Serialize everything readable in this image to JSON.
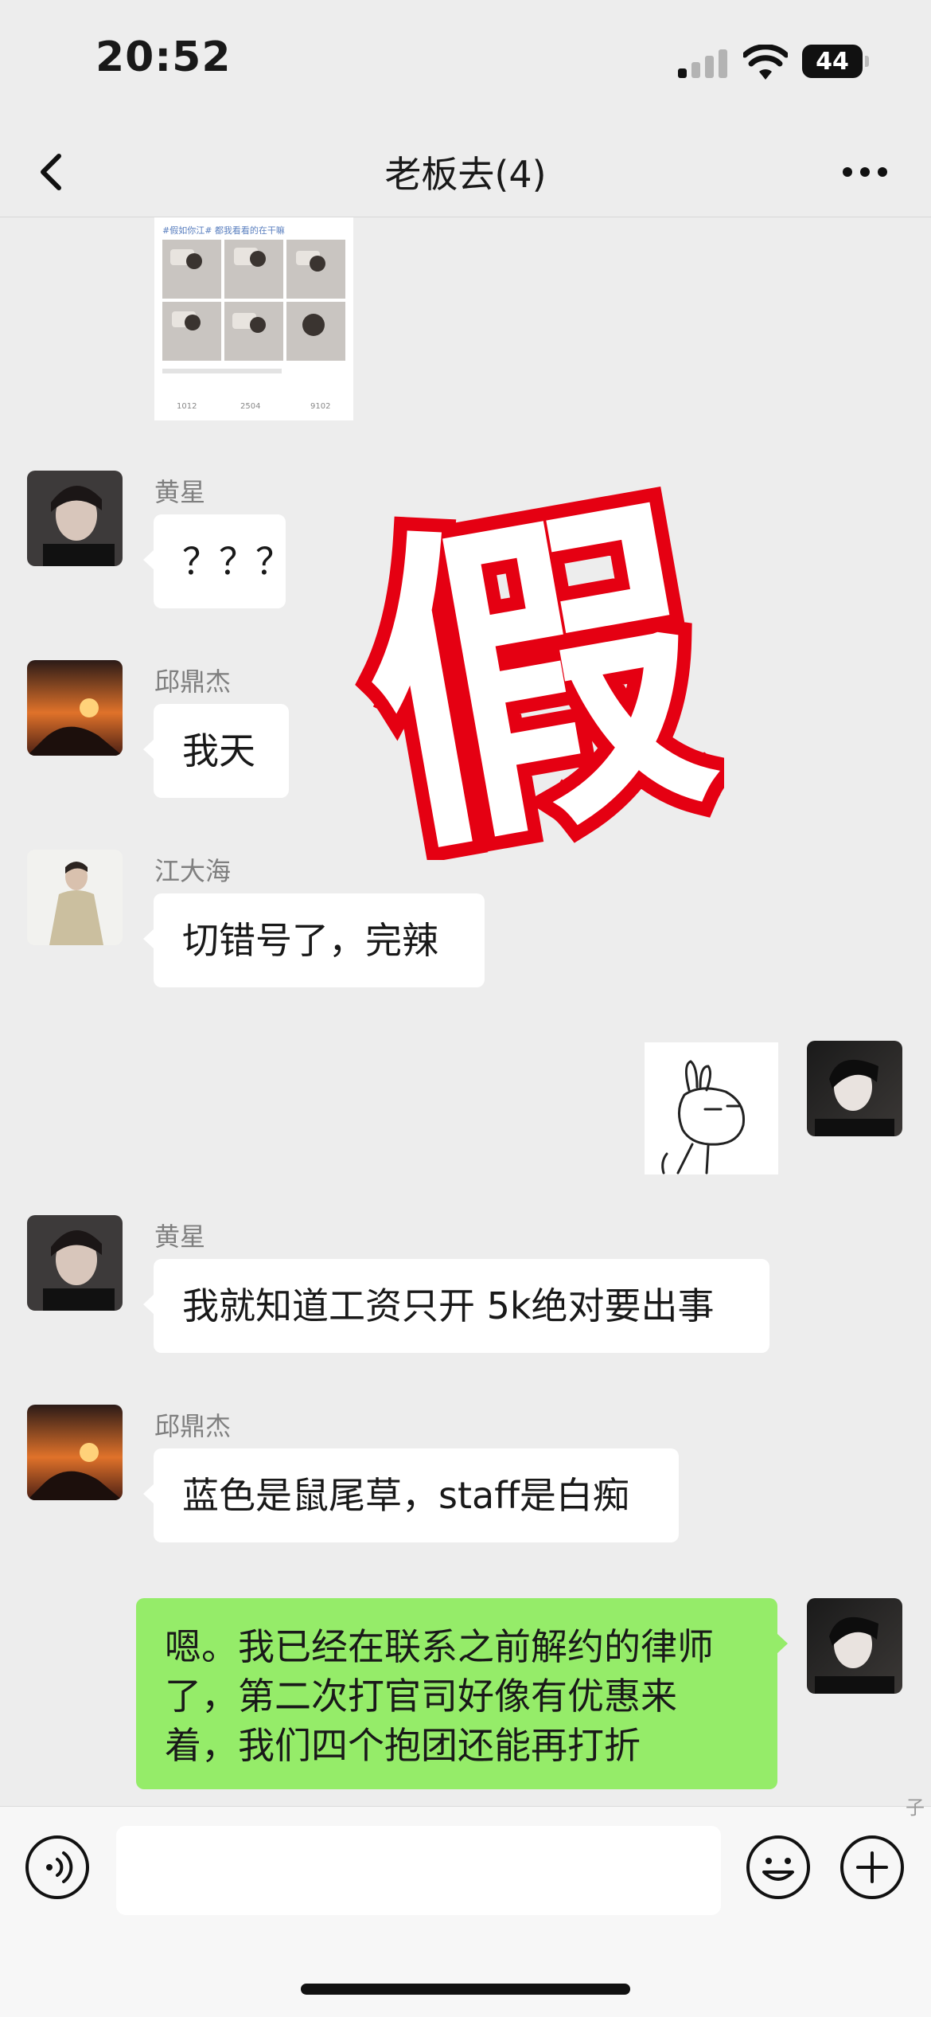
{
  "status_bar": {
    "time": "20:52",
    "battery": "44"
  },
  "nav": {
    "title": "老板去(4)"
  },
  "messages": [
    {
      "sender": "黄星",
      "text": "？？？"
    },
    {
      "sender": "邱鼎杰",
      "text": "我天"
    },
    {
      "sender": "江大海",
      "text": "切错号了，完辣"
    },
    {
      "sender": "黄星",
      "text": "我就知道工资只开 5k绝对要出事"
    },
    {
      "sender": "邱鼎杰",
      "text": "蓝色是鼠尾草，staff是白痴"
    },
    {
      "sender": "",
      "text": "嗯。我已经在联系之前解约的律师了，第二次打官司好像有优惠来着，我们四个抱团还能再打折"
    }
  ],
  "post_image": {
    "text": "#假如你江# 都我看看的在干嘛",
    "stats": [
      "1012",
      "2504",
      "9102"
    ]
  },
  "stamp": {
    "text": "假",
    "color": "#e50012"
  },
  "colors": {
    "own_bubble": "#95ec69",
    "other_bubble": "#ffffff",
    "background": "#ededed"
  },
  "input": {
    "placeholder": ""
  },
  "watermark": "子"
}
